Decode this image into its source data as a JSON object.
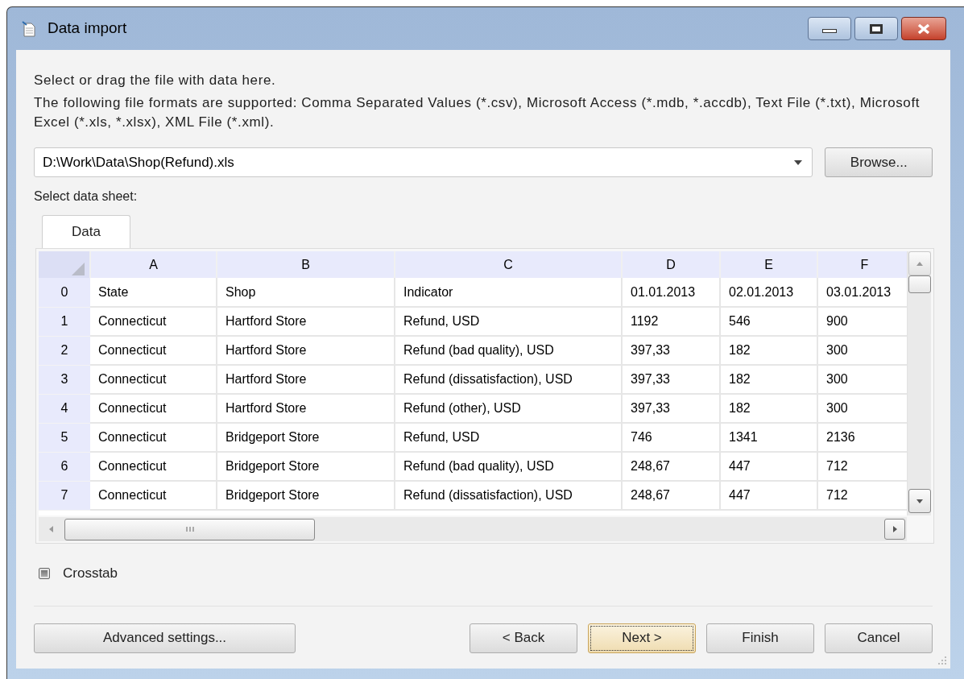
{
  "window": {
    "title": "Data import"
  },
  "intro": [
    "Select or drag the file with data here.",
    "The following file formats are supported: Comma Separated Values (*.csv), Microsoft Access (*.mdb, *.accdb), Text File (*.txt), Microsoft Excel (*.xls, *.xlsx), XML File (*.xml)."
  ],
  "file_field": {
    "value": "D:\\Work\\Data\\Shop(Refund).xls"
  },
  "browse_button": "Browse...",
  "sheet_label": "Select data sheet:",
  "tabs": [
    {
      "label": "Data",
      "selected": true
    }
  ],
  "table": {
    "columns": [
      "A",
      "B",
      "C",
      "D",
      "E",
      "F"
    ],
    "rows": [
      {
        "index": "0",
        "cells": [
          "State",
          "Shop",
          "Indicator",
          "01.01.2013",
          "02.01.2013",
          "03.01.2013"
        ]
      },
      {
        "index": "1",
        "cells": [
          "Connecticut",
          "Hartford Store",
          "Refund, USD",
          "1192",
          "546",
          "900"
        ]
      },
      {
        "index": "2",
        "cells": [
          "Connecticut",
          "Hartford Store",
          "Refund (bad quality), USD",
          "397,33",
          "182",
          "300"
        ]
      },
      {
        "index": "3",
        "cells": [
          "Connecticut",
          "Hartford Store",
          "Refund (dissatisfaction), USD",
          "397,33",
          "182",
          "300"
        ]
      },
      {
        "index": "4",
        "cells": [
          "Connecticut",
          "Hartford Store",
          "Refund (other), USD",
          "397,33",
          "182",
          "300"
        ]
      },
      {
        "index": "5",
        "cells": [
          "Connecticut",
          "Bridgeport Store",
          "Refund, USD",
          "746",
          "1341",
          "2136"
        ]
      },
      {
        "index": "6",
        "cells": [
          "Connecticut",
          "Bridgeport Store",
          "Refund (bad quality), USD",
          "248,67",
          "447",
          "712"
        ]
      },
      {
        "index": "7",
        "cells": [
          "Connecticut",
          "Bridgeport Store",
          "Refund (dissatisfaction), USD",
          "248,67",
          "447",
          "712"
        ]
      }
    ]
  },
  "crosstab": {
    "label": "Crosstab",
    "checked": false
  },
  "left_button": {
    "label": "Advanced settings...",
    "focused": false
  },
  "buttons": [
    {
      "label": "< Back",
      "focused": false
    },
    {
      "label": "Next >",
      "focused": true
    },
    {
      "label": "Finish",
      "focused": false
    },
    {
      "label": "Cancel",
      "focused": false
    }
  ]
}
